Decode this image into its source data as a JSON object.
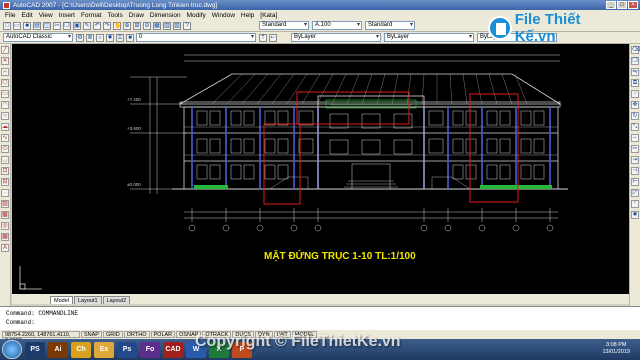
{
  "window": {
    "title": "AutoCAD 2007 - [C:\\Users\\Dell\\Desktop\\Truong Long Tri\\kien truc.dwg]"
  },
  "menu": [
    "File",
    "Edit",
    "View",
    "Insert",
    "Format",
    "Tools",
    "Draw",
    "Dimension",
    "Modify",
    "Window",
    "Help",
    "[Kata]"
  ],
  "toolbar": {
    "text_style": "Standard",
    "dim_style": "A.100",
    "table_style": "Standard",
    "workspace": "AutoCAD Classic",
    "layer": "0",
    "color": "ByLayer",
    "linetype": "ByLayer",
    "lineweight": "ByLayer"
  },
  "drawing": {
    "title": "MẶT ĐỨNG TRỤC 1-10  TL:1/100",
    "levels": [
      "+7.200",
      "+3.600",
      "±0.000"
    ],
    "colors": {
      "background": "#000000",
      "linework": "#d8d8d8",
      "highlight": "#e01b1b",
      "title": "#f2e600",
      "dims": "#c8c8c8",
      "plants": "#27b83a"
    }
  },
  "tabs": [
    "Model",
    "Layout1",
    "Layout2"
  ],
  "commandline": {
    "line1": "Command: COMMANDLINE",
    "line2": "Command:"
  },
  "statusbar": {
    "coords": "98754.2260, 148761.4110, 0.0000",
    "items": [
      "SNAP",
      "GRID",
      "ORTHO",
      "POLAR",
      "OSNAP",
      "OTRACK",
      "DUCS",
      "DYN",
      "LWT",
      "MODEL"
    ]
  },
  "taskbar": {
    "apps": [
      "PS",
      "Ai",
      "Ch",
      "Ex",
      "Ps",
      "Fo",
      "CAD",
      "W",
      "X",
      "P"
    ],
    "time": "3:08 PM",
    "date": "13/01/2019"
  },
  "watermark": {
    "logo": "File Thiết Kế.vn",
    "copyright": "Copyright © FileThietKe.vn"
  }
}
